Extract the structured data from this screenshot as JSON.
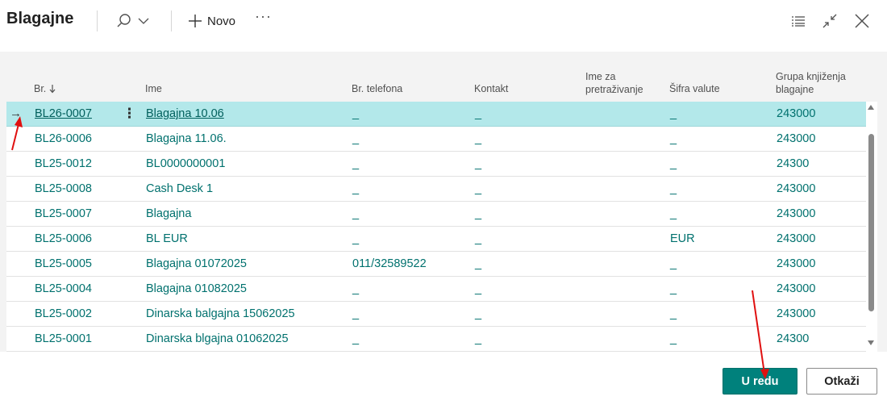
{
  "header": {
    "title": "Blagajne",
    "new_label": "Novo",
    "more_label": "···"
  },
  "columns": {
    "no": "Br.",
    "name": "Ime",
    "phone": "Br. telefona",
    "contact": "Kontakt",
    "search_name_l1": "Ime za",
    "search_name_l2": "pretraživanje",
    "currency": "Šifra valute",
    "posting_l1": "Grupa knjiženja",
    "posting_l2": "blagajne"
  },
  "rows": [
    {
      "no": "BL26-0007",
      "name": "Blagajna 10.06",
      "phone": "_",
      "contact": "_",
      "search": "",
      "currency": "_",
      "posting": "243000"
    },
    {
      "no": "BL26-0006",
      "name": "Blagajna 11.06.",
      "phone": "_",
      "contact": "_",
      "search": "",
      "currency": "_",
      "posting": "243000"
    },
    {
      "no": "BL25-0012",
      "name": "BL0000000001",
      "phone": "_",
      "contact": "_",
      "search": "",
      "currency": "_",
      "posting": "24300"
    },
    {
      "no": "BL25-0008",
      "name": "Cash Desk 1",
      "phone": "_",
      "contact": "_",
      "search": "",
      "currency": "_",
      "posting": "243000"
    },
    {
      "no": "BL25-0007",
      "name": "Blagajna",
      "phone": "_",
      "contact": "_",
      "search": "",
      "currency": "_",
      "posting": "243000"
    },
    {
      "no": "BL25-0006",
      "name": "BL EUR",
      "phone": "_",
      "contact": "_",
      "search": "",
      "currency": "EUR",
      "posting": "243000"
    },
    {
      "no": "BL25-0005",
      "name": "Blagajna 01072025",
      "phone": "011/32589522",
      "contact": "_",
      "search": "",
      "currency": "_",
      "posting": "243000"
    },
    {
      "no": "BL25-0004",
      "name": "Blagajna 01082025",
      "phone": "_",
      "contact": "_",
      "search": "",
      "currency": "_",
      "posting": "243000"
    },
    {
      "no": "BL25-0002",
      "name": "Dinarska balgajna 15062025",
      "phone": "_",
      "contact": "_",
      "search": "",
      "currency": "_",
      "posting": "243000"
    },
    {
      "no": "BL25-0001",
      "name": "Dinarska blgajna 01062025",
      "phone": "_",
      "contact": "_",
      "search": "",
      "currency": "_",
      "posting": "24300"
    }
  ],
  "selected_row_indicator": "→",
  "row_menu_glyph": "⋮",
  "footer": {
    "ok_label": "U redu",
    "cancel_label": "Otkaži"
  },
  "colors": {
    "accent": "#00817c",
    "link": "#00716e",
    "selected_row": "#b3e8ea",
    "annotation_arrow": "#e01010"
  }
}
